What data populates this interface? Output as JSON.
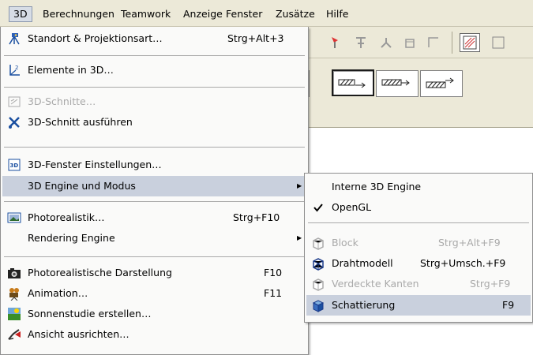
{
  "menubar": {
    "items": [
      {
        "label": "3D",
        "active": true
      },
      {
        "label": "Berechnungen"
      },
      {
        "label": "Teamwork"
      },
      {
        "label": "Anzeige"
      },
      {
        "label": "Fenster"
      },
      {
        "label": "Zusätze"
      },
      {
        "label": "Hilfe"
      }
    ]
  },
  "menu_3d": {
    "items": [
      {
        "label": "Standort & Projektionsart…",
        "shortcut": "Strg+Alt+3",
        "icon": "camera-tripod-icon"
      },
      {
        "label": "Elemente in 3D…",
        "icon": "axes-icon"
      },
      {
        "label": "3D-Schnitte…",
        "icon": "cut-planes-icon",
        "disabled": true
      },
      {
        "label": "3D-Schnitt ausführen",
        "icon": "scissors-icon"
      },
      {
        "label": "3D-Fenster Einstellungen…",
        "icon": "window-settings-icon"
      },
      {
        "label": "3D Engine und Modus",
        "submenu": true
      },
      {
        "label": "Photorealistik…",
        "shortcut": "Strg+F10",
        "icon": "photo-icon"
      },
      {
        "label": "Rendering Engine",
        "submenu": true
      },
      {
        "label": "Photorealistische Darstellung",
        "shortcut": "F10",
        "icon": "camera-icon"
      },
      {
        "label": "Animation…",
        "shortcut": "F11",
        "icon": "film-camera-icon"
      },
      {
        "label": "Sonnenstudie erstellen…",
        "icon": "sun-study-icon"
      },
      {
        "label": "Ansicht ausrichten…",
        "icon": "align-view-icon"
      }
    ]
  },
  "submenu_engine": {
    "items": [
      {
        "label": "Interne 3D Engine"
      },
      {
        "label": "OpenGL",
        "checked": true
      },
      {
        "label": "Block",
        "shortcut": "Strg+Alt+F9",
        "icon": "block-icon",
        "disabled": true
      },
      {
        "label": "Drahtmodell",
        "shortcut": "Strg+Umsch.+F9",
        "icon": "wireframe-icon"
      },
      {
        "label": "Verdeckte Kanten",
        "shortcut": "Strg+F9",
        "icon": "hidden-lines-icon",
        "disabled": true
      },
      {
        "label": "Schattierung",
        "shortcut": "F9",
        "icon": "shading-icon",
        "highlighted": true
      }
    ]
  },
  "colors": {
    "menubar_bg": "#ece9d8",
    "menu_bg": "#fafaf9",
    "highlight": "#c9d0dd",
    "disabled_text": "#a9a9a9"
  }
}
